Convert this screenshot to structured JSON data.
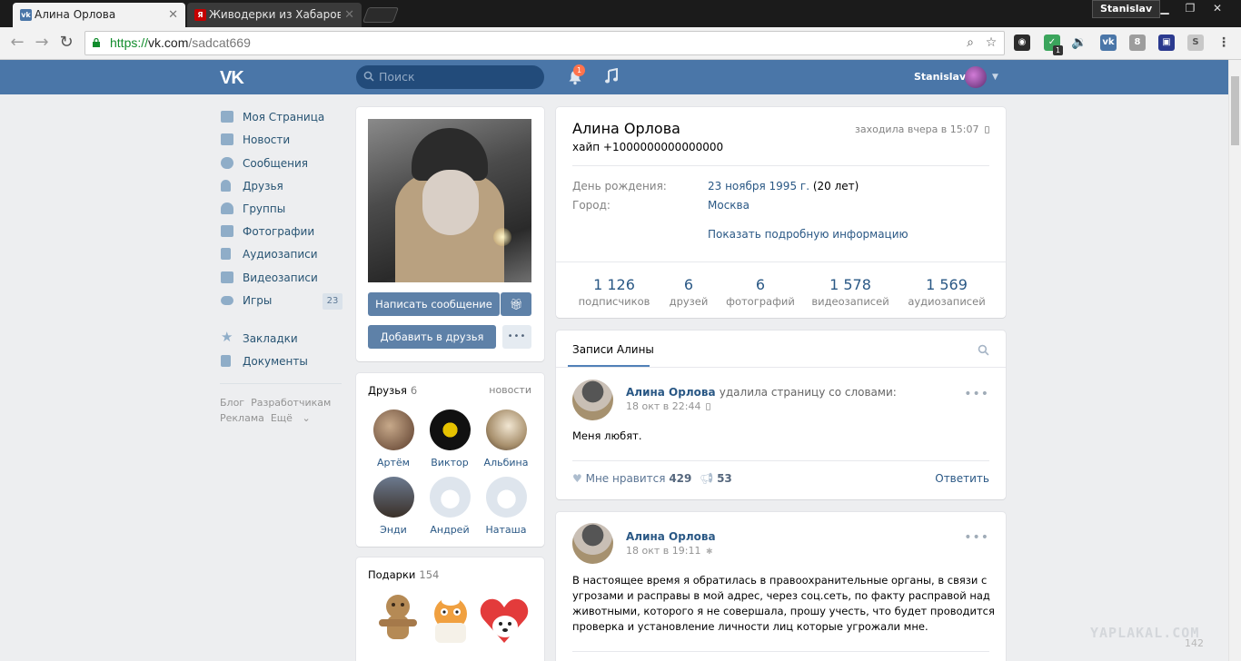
{
  "browser": {
    "tabs": [
      {
        "title": "Алина Орлова",
        "active": true
      },
      {
        "title": "Живодерки из Хабаровс"
      }
    ],
    "profile_chip": "Stanislav",
    "url": {
      "scheme": "https://",
      "host": "vk.com",
      "path": "/sadcat669"
    },
    "extension_badge": "1"
  },
  "vk_header": {
    "logo": "VK",
    "search_placeholder": "Поиск",
    "notifications_count": "1",
    "username": "Stanislav"
  },
  "left_menu": {
    "items": [
      {
        "label": "Моя Страница",
        "icon": "home-icon"
      },
      {
        "label": "Новости",
        "icon": "news-icon"
      },
      {
        "label": "Сообщения",
        "icon": "messages-icon"
      },
      {
        "label": "Друзья",
        "icon": "friends-icon"
      },
      {
        "label": "Группы",
        "icon": "groups-icon"
      },
      {
        "label": "Фотографии",
        "icon": "camera-icon"
      },
      {
        "label": "Аудиозаписи",
        "icon": "music-icon"
      },
      {
        "label": "Видеозаписи",
        "icon": "video-icon"
      },
      {
        "label": "Игры",
        "icon": "gamepad-icon",
        "count": "23"
      },
      {
        "label": "Закладки",
        "icon": "star-icon"
      },
      {
        "label": "Документы",
        "icon": "document-icon"
      }
    ],
    "footer": [
      "Блог",
      "Разработчикам",
      "Реклама",
      "Ещё"
    ]
  },
  "profile_actions": {
    "message_button": "Написать сообщение",
    "add_friend_button": "Добавить в друзья",
    "more_button": "•••"
  },
  "friends_block": {
    "title": "Друзья",
    "count": "6",
    "link": "новости",
    "friends": [
      "Артём",
      "Виктор",
      "Альбина",
      "Энди",
      "Андрей",
      "Наташа"
    ]
  },
  "gifts_block": {
    "title": "Подарки",
    "count": "154"
  },
  "profile": {
    "name": "Алина Орлова",
    "status": "хайп +1000000000000000",
    "last_seen": "заходила вчера в 15:07",
    "birthday_label": "День рождения:",
    "birthday_date": "23 ноября 1995 г.",
    "birthday_age": "(20 лет)",
    "city_label": "Город:",
    "city": "Москва",
    "more_info": "Показать подробную информацию",
    "counters": [
      {
        "value": "1 126",
        "label": "подписчиков"
      },
      {
        "value": "6",
        "label": "друзей"
      },
      {
        "value": "6",
        "label": "фотографий"
      },
      {
        "value": "1 578",
        "label": "видеозаписей"
      },
      {
        "value": "1 569",
        "label": "аудиозаписей"
      }
    ]
  },
  "wall": {
    "tab": "Записи Алины"
  },
  "posts": [
    {
      "author": "Алина Орлова",
      "action": "удалила страницу со словами:",
      "date": "18 окт в 22:44",
      "text": "Меня любят.",
      "likes_label": "Мне нравится",
      "likes": "429",
      "reposts": "53",
      "reply": "Ответить"
    },
    {
      "author": "Алина Орлова",
      "date": "18 окт в 19:11",
      "text_lines": [
        "В настоящее время я обратилась в правоохранительные органы, в связи с",
        "угрозами и расправы в мой адрес, через соц.сеть, по факту расправой над",
        "животными, которого я не совершала, прошу учесть, что будет проводится",
        "проверка и установление личности лиц которые угрожали мне."
      ]
    }
  ],
  "watermark": "YAPLAKAL.COM",
  "watermark_sub": "142"
}
